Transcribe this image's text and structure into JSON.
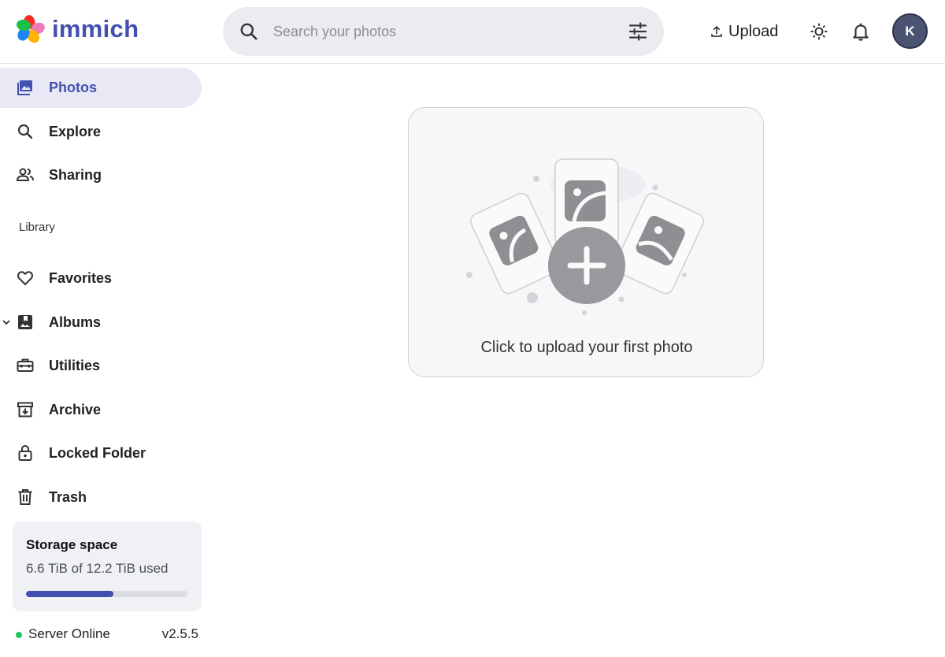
{
  "app": {
    "logo_text": "immich",
    "logo_icon": "immich-pinwheel-logo"
  },
  "header": {
    "search_placeholder": "Search your photos",
    "search_icon": "search-icon",
    "filter_icon": "tune-icon",
    "upload_label": "Upload",
    "avatar_initial": "K"
  },
  "sidebar": {
    "top_items": [
      {
        "label": "Photos",
        "icon": "photos-icon",
        "active": true
      },
      {
        "label": "Explore",
        "icon": "search-icon"
      },
      {
        "label": "Sharing",
        "icon": "people-icon"
      }
    ],
    "library_label": "Library",
    "library_items": [
      {
        "label": "Favorites",
        "icon": "heart-icon"
      },
      {
        "label": "Albums",
        "icon": "album-icon",
        "expandable": true
      },
      {
        "label": "Utilities",
        "icon": "toolbox-icon"
      },
      {
        "label": "Archive",
        "icon": "archive-icon"
      },
      {
        "label": "Locked Folder",
        "icon": "lock-icon"
      },
      {
        "label": "Trash",
        "icon": "trash-icon"
      }
    ],
    "storage": {
      "title": "Storage space",
      "usage": "6.6 TiB of 12.2 TiB used",
      "used_fraction": 0.54
    },
    "server": {
      "status": "Server Online",
      "version": "v2.5.5",
      "status_color": "#22c55e"
    }
  },
  "main": {
    "empty_caption": "Click to upload your first photo"
  },
  "colors": {
    "accent": "#4250af",
    "active_bg": "#e8e9f5"
  }
}
